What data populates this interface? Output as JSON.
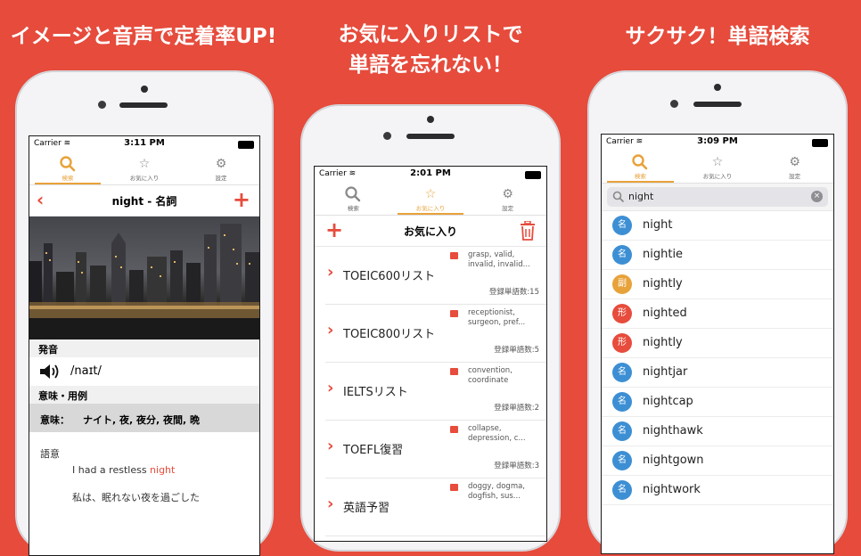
{
  "headlines": {
    "left": "イメージと音声で定着率UP!",
    "center_line1": "お気に入りリストで",
    "center_line2": "単語を忘れない！",
    "right": "サクサク！単語検索"
  },
  "colors": {
    "background": "#e64b3c",
    "accent": "#e8a23a",
    "red": "#e74c3c",
    "blue": "#3d8fd4",
    "orange": "#e8a23a"
  },
  "tabs": {
    "search": "検索",
    "favorites": "お気に入り",
    "settings": "設定"
  },
  "phone_left": {
    "carrier": "Carrier",
    "time": "3:11 PM",
    "title": "night - 名詞",
    "pronunciation_label": "発音",
    "ipa": "/naɪt/",
    "meaning_header": "意味・用例",
    "meaning_label": "意味：",
    "meaning_text": "ナイト, 夜, 夜分, 夜間, 晩",
    "example_label": "語意",
    "example_en_prefix": "I had a restless ",
    "example_en_highlight": "night",
    "example_ja": "私は、眠れない夜を過ごした"
  },
  "phone_center": {
    "carrier": "Carrier",
    "time": "2:01 PM",
    "title": "お気に入り",
    "lists": [
      {
        "name": "TOEIC600リスト",
        "words": "grasp, valid, invalid, invalid...",
        "count": "登録単語数:15"
      },
      {
        "name": "TOEIC800リスト",
        "words": "receptionist, surgeon, pref...",
        "count": "登録単語数:5"
      },
      {
        "name": "IELTSリスト",
        "words": "convention, coordinate",
        "count": "登録単語数:2"
      },
      {
        "name": "TOEFL復習",
        "words": "collapse, depression, c...",
        "count": "登録単語数:3"
      },
      {
        "name": "英語予習",
        "words": "doggy, dogma, dogfish, sus...",
        "count": ""
      }
    ]
  },
  "phone_right": {
    "carrier": "Carrier",
    "time": "3:09 PM",
    "search_value": "night",
    "results": [
      {
        "pos": "名",
        "word": "night",
        "color": "blue"
      },
      {
        "pos": "名",
        "word": "nightie",
        "color": "blue"
      },
      {
        "pos": "副",
        "word": "nightly",
        "color": "orange"
      },
      {
        "pos": "形",
        "word": "nighted",
        "color": "red"
      },
      {
        "pos": "形",
        "word": "nightly",
        "color": "red"
      },
      {
        "pos": "名",
        "word": "nightjar",
        "color": "blue"
      },
      {
        "pos": "名",
        "word": "nightcap",
        "color": "blue"
      },
      {
        "pos": "名",
        "word": "nighthawk",
        "color": "blue"
      },
      {
        "pos": "名",
        "word": "nightgown",
        "color": "blue"
      },
      {
        "pos": "名",
        "word": "nightwork",
        "color": "blue"
      }
    ]
  }
}
